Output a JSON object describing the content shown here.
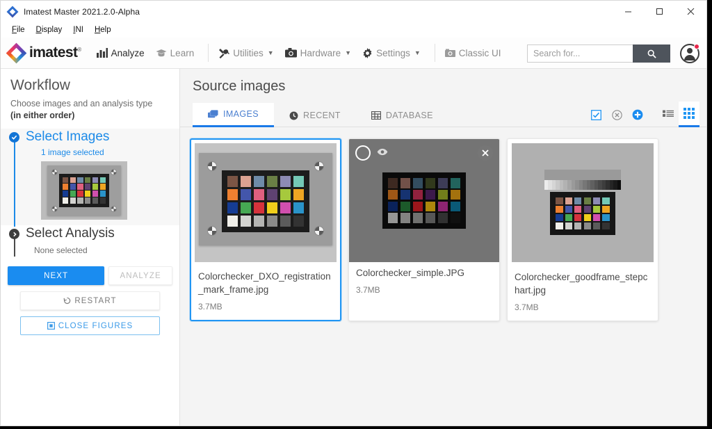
{
  "window": {
    "title": "Imatest Master 2021.2.0-Alpha",
    "app_icon": "imatest-diamond-icon",
    "controls": {
      "minimize": "minimize-icon",
      "maximize": "maximize-icon",
      "close": "close-icon"
    }
  },
  "menubar": {
    "items": [
      "File",
      "Display",
      "INI",
      "Help"
    ]
  },
  "toolbar": {
    "brand": "imatest",
    "brand_mark": "®",
    "items": [
      {
        "label": "Analyze",
        "icon": "chart-bar-icon",
        "active": true,
        "caret": false
      },
      {
        "label": "Learn",
        "icon": "graduation-cap-icon",
        "active": false,
        "caret": false
      },
      {
        "label": "Utilities",
        "icon": "tools-icon",
        "active": false,
        "caret": true
      },
      {
        "label": "Hardware",
        "icon": "camera-icon",
        "active": false,
        "caret": true
      },
      {
        "label": "Settings",
        "icon": "gear-icon",
        "active": false,
        "caret": true
      },
      {
        "label": "Classic UI",
        "icon": "camera-retro-icon",
        "active": false,
        "caret": false
      }
    ],
    "search": {
      "placeholder": "Search for...",
      "value": "",
      "button_icon": "search-icon"
    },
    "avatar": {
      "icon": "user-avatar-icon",
      "badge": true,
      "badge_color": "#e8254a"
    }
  },
  "sidebar": {
    "title": "Workflow",
    "subtitle_line1": "Choose images and an analysis type",
    "subtitle_line2": "(in either order)",
    "steps": [
      {
        "name": "Select Images",
        "note": "1 image selected",
        "state": "done",
        "icon": "check-circle-icon",
        "has_thumbnail": true
      },
      {
        "name": "Select Analysis",
        "note": "None selected",
        "state": "pending",
        "icon": "chevron-right-circle-icon",
        "has_thumbnail": false
      }
    ],
    "buttons": {
      "next": "NEXT",
      "analyze": "ANALYZE",
      "restart": "RESTART",
      "restart_icon": "undo-icon",
      "close_figures": "CLOSE FIGURES",
      "close_figures_icon": "window-close-icon"
    }
  },
  "content": {
    "title": "Source images",
    "tabs": [
      {
        "label": "IMAGES",
        "icon": "images-stack-icon",
        "active": true
      },
      {
        "label": "RECENT",
        "icon": "clock-icon",
        "active": false
      },
      {
        "label": "DATABASE",
        "icon": "table-grid-icon",
        "active": false
      }
    ],
    "view_tools": [
      {
        "name": "select-all-checkbox",
        "icon": "checkbox-checked-icon",
        "color": "#2196f3"
      },
      {
        "name": "clear-selection",
        "icon": "x-circle-icon",
        "color": "#8d8d8d"
      },
      {
        "name": "add-images",
        "icon": "plus-circle-icon",
        "color": "#1a8cf0"
      },
      {
        "name": "list-view",
        "icon": "list-view-icon",
        "color": "#6d6d6d",
        "active": false
      },
      {
        "name": "grid-view",
        "icon": "grid-view-icon",
        "color": "#2196f3",
        "active": true
      }
    ],
    "cards": [
      {
        "filename": "Colorchecker_DXO_registration_mark_frame.jpg",
        "size": "3.7MB",
        "selected": true,
        "hovered": false,
        "thumbnail": "colorchecker-framed"
      },
      {
        "filename": "Colorchecker_simple.JPG",
        "size": "3.7MB",
        "selected": false,
        "hovered": true,
        "thumbnail": "colorchecker-simple",
        "overlay": {
          "select_icon": "circle-outline-icon",
          "preview_icon": "eye-icon",
          "remove_icon": "close-x-icon"
        }
      },
      {
        "filename": "Colorchecker_goodframe_stepchart.jpg",
        "size": "3.7MB",
        "selected": false,
        "hovered": false,
        "thumbnail": "colorchecker-stepchart"
      }
    ]
  },
  "colors": {
    "accent_blue": "#1a8cf0",
    "tab_blue": "#2196f3",
    "sidebar_bg": "#ffffff",
    "content_bg": "#f4f4f4"
  },
  "colorchecker_patches": [
    "#7b5545",
    "#dba292",
    "#6f8ba8",
    "#6a7f45",
    "#8d8bb4",
    "#74c8b6",
    "#ee8030",
    "#4356ab",
    "#e0607f",
    "#5f4271",
    "#a6c93d",
    "#eea623",
    "#153c93",
    "#46a853",
    "#d6333c",
    "#f0cf1b",
    "#d14fae",
    "#2a93c9",
    "#f0efe9",
    "#d3d3d0",
    "#b4b4b2",
    "#8b8b8a",
    "#5b5b5b",
    "#333333"
  ],
  "colorchecker_patches_dim": [
    "#4b3329",
    "#8c6359",
    "#3f5e74",
    "#3c4623",
    "#4b4a6b",
    "#2a7a72",
    "#c26c1c",
    "#1c3f8a",
    "#b22a4c",
    "#4a1f5c",
    "#8a9a22",
    "#c98c12",
    "#0d2a70",
    "#236e34",
    "#c01c22",
    "#d4a510",
    "#ad2d8a",
    "#0d6d92",
    "#b8b8b6",
    "#a0a09e",
    "#8a8a88",
    "#6b6b6a",
    "#3c3c3c",
    "#141414"
  ]
}
